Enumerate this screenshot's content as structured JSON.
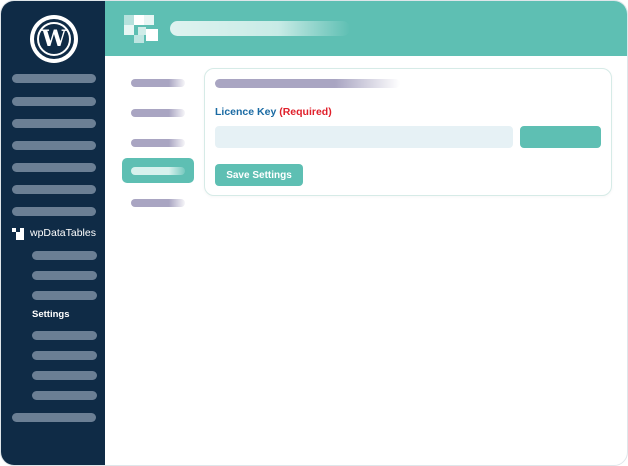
{
  "sidebar": {
    "logo_icon": "wordpress-icon",
    "plugin_label": "wpDataTables",
    "plugin_icon": "wpdatatables-icon",
    "submenu_active_label": "Settings"
  },
  "topbar": {
    "logo_icon": "wpdatatables-logo-icon"
  },
  "card": {
    "licence_label": "Licence Key",
    "required_label": "(Required)",
    "licence_input_value": "",
    "save_button_label": "Save Settings"
  },
  "colors": {
    "sidebar_bg": "#0f2b46",
    "accent": "#5ebfb3",
    "label_blue": "#1a6aa3",
    "required_red": "#e0202b"
  }
}
